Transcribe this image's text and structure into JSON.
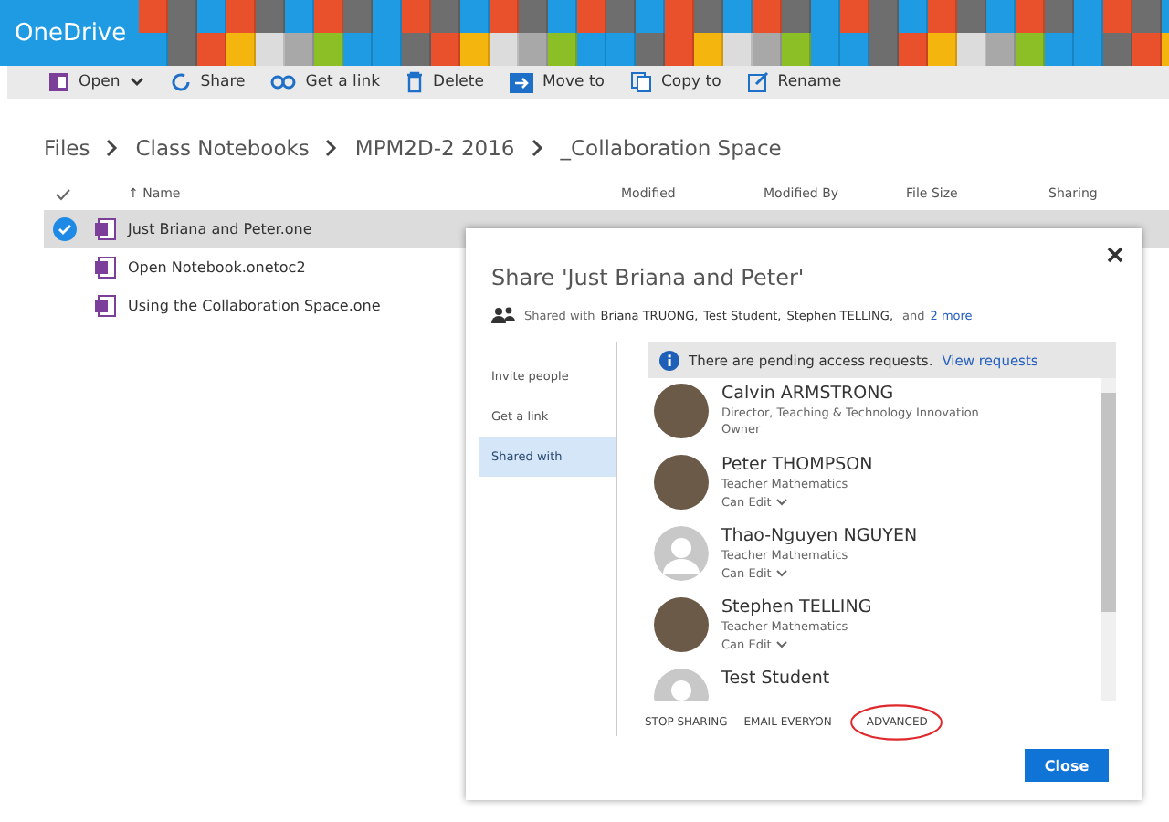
{
  "app": {
    "name": "OneDrive"
  },
  "commands": [
    {
      "label": "Open",
      "dropdown": true
    },
    {
      "label": "Share",
      "dropdown": false
    },
    {
      "label": "Get a link",
      "dropdown": false
    },
    {
      "label": "Delete",
      "dropdown": false
    },
    {
      "label": "Move to",
      "dropdown": false
    },
    {
      "label": "Copy to",
      "dropdown": false
    },
    {
      "label": "Rename",
      "dropdown": false
    }
  ],
  "breadcrumb": [
    "Files",
    "Class Notebooks",
    "MPM2D-2 2016",
    "_Collaboration Space"
  ],
  "table": {
    "sort_indicator": "↑",
    "columns": [
      "Name",
      "Modified",
      "Modified By",
      "File Size",
      "Sharing"
    ],
    "rows": [
      {
        "name": "Just Briana and Peter.one",
        "selected": true
      },
      {
        "name": "Open Notebook.onetoc2",
        "selected": false
      },
      {
        "name": "Using the Collaboration Space.one",
        "selected": false
      }
    ]
  },
  "dialog": {
    "title": "Share 'Just Briana and Peter'",
    "shared_with_label": "Shared with",
    "shared_with_names": [
      "Briana TRUONG,",
      "Test Student,",
      "Stephen TELLING,"
    ],
    "and_text": "and",
    "more_link": "2 more",
    "nav": [
      {
        "label": "Invite people",
        "selected": false
      },
      {
        "label": "Get a link",
        "selected": false
      },
      {
        "label": "Shared with",
        "selected": true
      }
    ],
    "notice": {
      "text": "There are pending access requests.",
      "link": "View requests"
    },
    "people": [
      {
        "name": "Calvin ARMSTRONG",
        "kind": "photo",
        "role": "Director, Teaching & Technology Innovation",
        "permission": "Owner",
        "dropdown": false
      },
      {
        "name": "Peter THOMPSON",
        "kind": "photo",
        "role": "Teacher Mathematics",
        "permission": "Can Edit",
        "dropdown": true
      },
      {
        "name": "Thao-Nguyen NGUYEN",
        "kind": "default",
        "role": "Teacher Mathematics",
        "permission": "Can Edit",
        "dropdown": true
      },
      {
        "name": "Stephen TELLING",
        "kind": "photo",
        "role": "Teacher Mathematics",
        "permission": "Can Edit",
        "dropdown": true
      },
      {
        "name": "Test Student",
        "kind": "default"
      }
    ],
    "actions": [
      "STOP SHARING",
      "EMAIL EVERYON",
      "ADVANCED"
    ],
    "close_button": "Close"
  }
}
